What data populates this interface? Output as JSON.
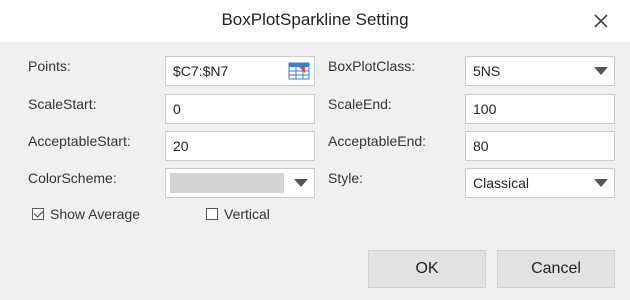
{
  "dialog": {
    "title": "BoxPlotSparkline Setting",
    "close_icon": "close-icon"
  },
  "form": {
    "points_label": "Points:",
    "points_value": "$C7:$N7",
    "boxplotclass_label": "BoxPlotClass:",
    "boxplotclass_value": "5NS",
    "scalestart_label": "ScaleStart:",
    "scalestart_value": "0",
    "scaleend_label": "ScaleEnd:",
    "scaleend_value": "100",
    "acceptablestart_label": "AcceptableStart:",
    "acceptablestart_value": "20",
    "acceptableend_label": "AcceptableEnd:",
    "acceptableend_value": "80",
    "colorscheme_label": "ColorScheme:",
    "colorscheme_swatch": "#d3d3d3",
    "style_label": "Style:",
    "style_value": "Classical",
    "show_average_label": "Show Average",
    "show_average_checked": true,
    "vertical_label": "Vertical",
    "vertical_checked": false
  },
  "buttons": {
    "ok_label": "OK",
    "cancel_label": "Cancel"
  }
}
